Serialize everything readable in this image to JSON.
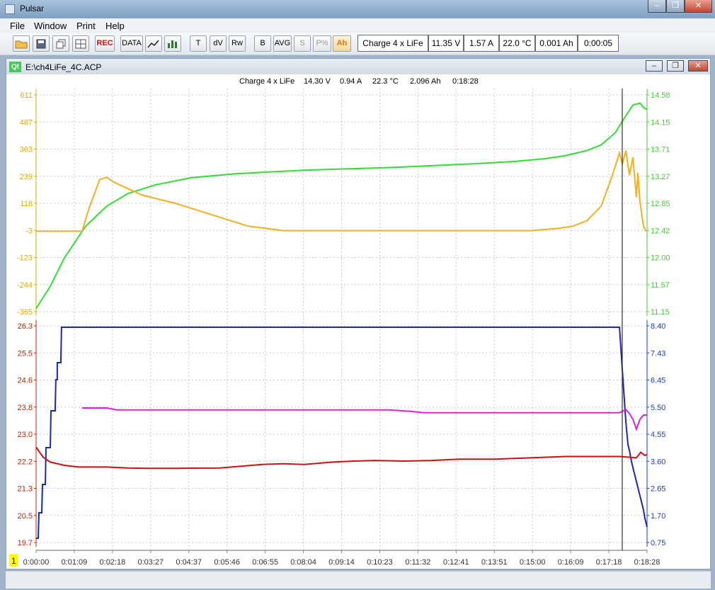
{
  "app_title": "Pulsar",
  "window_controls": [
    "‒",
    "❐",
    "✕"
  ],
  "menu": [
    "File",
    "Window",
    "Print",
    "Help"
  ],
  "toolbar": {
    "buttons": [
      "REC",
      "DATA",
      "T",
      "dV",
      "Rw",
      "B",
      "AVG",
      "S",
      "P%",
      "Ah"
    ],
    "icons": [
      "open-icon",
      "save-icon",
      "copy-icon",
      "grid-icon",
      "chart-icon",
      "bar-icon"
    ],
    "readouts": [
      "Charge 4 x LiFe",
      "11.35 V",
      "1.57 A",
      "22.0 °C",
      "0.001 Ah",
      "0:00:05"
    ]
  },
  "document": {
    "title": "E:\\ch4LiFe_4C.ACP",
    "qt_label": "Qt",
    "cursor_info": [
      "Charge 4 x LiFe",
      "14.30 V",
      "0.94 A",
      "22.3 °C",
      "2.096 Ah",
      "0:18:28"
    ],
    "page_marker": "1"
  },
  "chart_data": [
    {
      "type": "line",
      "left_ticks": [
        "611",
        "487",
        "363",
        "239",
        "118",
        "-3",
        "-123",
        "-244",
        "-365"
      ],
      "right_ticks": [
        "14.58",
        "14.15",
        "13.71",
        "13.27",
        "12.85",
        "12.42",
        "12.00",
        "11.57",
        "11.15"
      ],
      "left_color": "#e0a800",
      "right_color": "#3fcf2f",
      "series": [
        {
          "color": "#33dd33",
          "axis": "right",
          "x": [
            0,
            20,
            40,
            70,
            100,
            130,
            170,
            220,
            280,
            330,
            380,
            440,
            500,
            560,
            620,
            680,
            720,
            750,
            780,
            800,
            820,
            835,
            845,
            855,
            860,
            865
          ],
          "y": [
            11.2,
            11.55,
            12.0,
            12.5,
            12.82,
            13.02,
            13.16,
            13.27,
            13.33,
            13.36,
            13.39,
            13.41,
            13.43,
            13.46,
            13.49,
            13.53,
            13.57,
            13.62,
            13.7,
            13.79,
            13.98,
            14.25,
            14.42,
            14.45,
            14.38,
            14.35
          ]
        },
        {
          "color": "#f0b020",
          "axis": "left",
          "x": [
            0,
            65,
            75,
            90,
            100,
            110,
            150,
            200,
            250,
            300,
            350,
            400,
            450,
            500,
            550,
            600,
            650,
            700,
            740,
            760,
            780,
            800,
            815,
            826,
            830,
            835,
            840,
            845,
            850,
            852,
            855,
            860,
            863,
            865
          ],
          "y": [
            -3,
            -3,
            100,
            230,
            240,
            218,
            160,
            120,
            70,
            20,
            0,
            0,
            0,
            0,
            0,
            0,
            0,
            0,
            10,
            20,
            45,
            110,
            240,
            350,
            300,
            360,
            250,
            330,
            150,
            260,
            130,
            20,
            0,
            -3
          ]
        }
      ]
    },
    {
      "type": "line",
      "left_ticks": [
        "26.3",
        "25.5",
        "24.6",
        "23.8",
        "23.0",
        "22.2",
        "21.3",
        "20.5",
        "19.7"
      ],
      "right_ticks": [
        "8.40",
        "7.43",
        "6.45",
        "5.50",
        "4.55",
        "3.60",
        "2.65",
        "1.70",
        "0.75"
      ],
      "left_color": "#cc2200",
      "right_color": "#1a3fcf",
      "x_ticks": [
        "0:00:00",
        "0:01:09",
        "0:02:18",
        "0:03:27",
        "0:04:37",
        "0:05:46",
        "0:06:55",
        "0:08:04",
        "0:09:14",
        "0:10:23",
        "0:11:32",
        "0:12:41",
        "0:13:51",
        "0:15:00",
        "0:16:09",
        "0:17:18",
        "0:18:28"
      ],
      "series": [
        {
          "color": "#1a28b8",
          "axis": "right",
          "x": [
            0,
            3,
            4,
            8,
            9,
            13,
            14,
            20,
            21,
            27,
            28,
            30,
            30,
            35,
            36,
            42,
            43,
            48,
            48,
            50,
            826,
            829,
            832,
            835,
            838,
            840,
            843,
            846,
            849,
            852,
            855,
            858,
            860,
            862,
            865
          ],
          "y": [
            0.9,
            0.9,
            1.8,
            1.8,
            2.8,
            2.8,
            4.1,
            4.1,
            5.4,
            5.4,
            6.5,
            6.5,
            7.1,
            7.1,
            8.35,
            8.35,
            8.35,
            8.35,
            8.35,
            8.35,
            8.35,
            7.2,
            6.1,
            5.0,
            4.2,
            4.0,
            3.6,
            3.3,
            3.0,
            2.7,
            2.4,
            2.1,
            1.9,
            1.6,
            1.3
          ]
        },
        {
          "color": "#dd22dd",
          "axis": "right",
          "x": [
            65,
            100,
            115,
            400,
            500,
            530,
            550,
            600,
            700,
            800,
            826,
            835,
            840,
            845,
            850,
            855,
            860,
            865
          ],
          "y": [
            5.5,
            5.5,
            5.43,
            5.43,
            5.43,
            5.38,
            5.33,
            5.33,
            5.33,
            5.33,
            5.33,
            5.45,
            5.3,
            5.1,
            4.75,
            5.1,
            5.25,
            5.25
          ]
        },
        {
          "color": "#cc1111",
          "axis": "left",
          "x": [
            0,
            10,
            20,
            40,
            60,
            80,
            100,
            130,
            160,
            200,
            260,
            320,
            350,
            380,
            420,
            450,
            480,
            520,
            560,
            600,
            650,
            700,
            750,
            800,
            826,
            840,
            850,
            856,
            862,
            865
          ],
          "y": [
            22.6,
            22.3,
            22.15,
            22.05,
            22.0,
            22.0,
            22.0,
            21.97,
            21.96,
            21.96,
            21.97,
            22.08,
            22.1,
            22.08,
            22.15,
            22.18,
            22.2,
            22.18,
            22.2,
            22.24,
            22.24,
            22.28,
            22.32,
            22.32,
            22.32,
            22.3,
            22.28,
            22.45,
            22.35,
            22.38
          ]
        }
      ]
    }
  ]
}
